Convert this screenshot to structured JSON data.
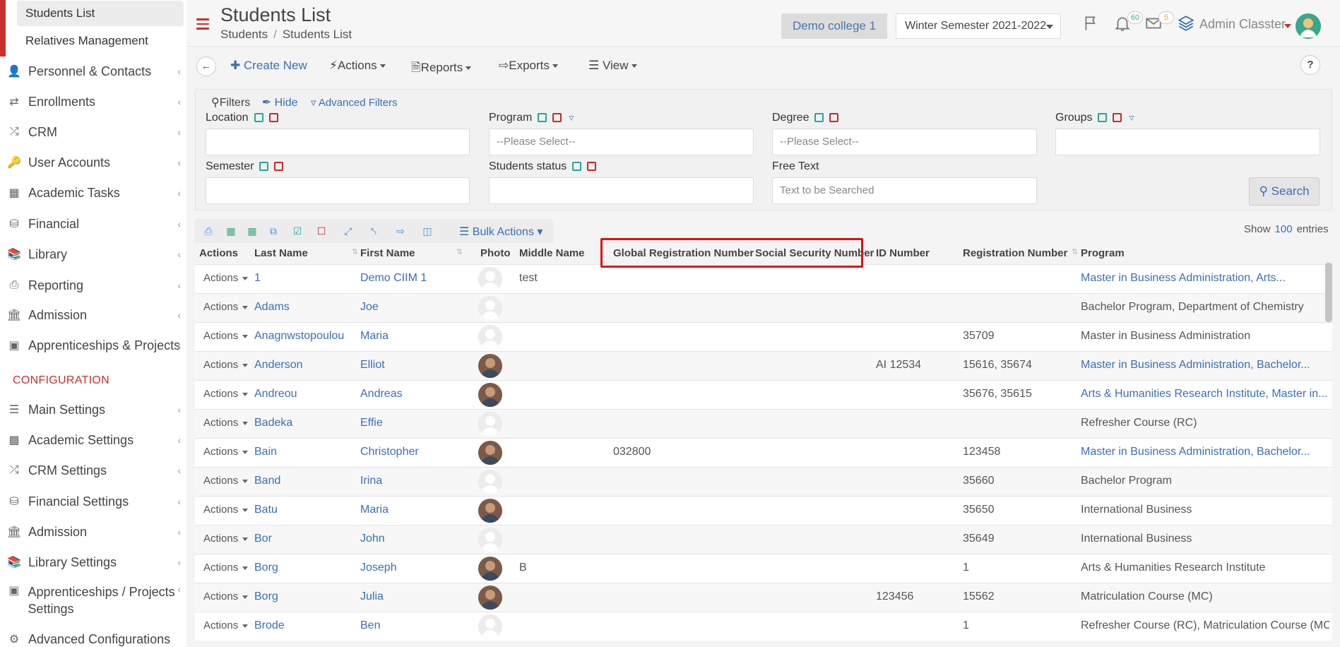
{
  "sidebar": {
    "sub_items": [
      {
        "label": "Students List"
      },
      {
        "label": "Relatives Management"
      }
    ],
    "main_items": [
      {
        "label": "Personnel & Contacts",
        "icon": "person-icon"
      },
      {
        "label": "Enrollments",
        "icon": "arrows-icon"
      },
      {
        "label": "CRM",
        "icon": "shuffle-icon"
      },
      {
        "label": "User Accounts",
        "icon": "key-icon"
      },
      {
        "label": "Academic Tasks",
        "icon": "grid-icon"
      },
      {
        "label": "Financial",
        "icon": "coins-icon"
      },
      {
        "label": "Library",
        "icon": "books-icon"
      },
      {
        "label": "Reporting",
        "icon": "print-icon"
      },
      {
        "label": "Admission",
        "icon": "institution-icon"
      },
      {
        "label": "Apprenticeships & Projects",
        "icon": "box-icon"
      }
    ],
    "config_title": "CONFIGURATION",
    "config_items": [
      {
        "label": "Main Settings",
        "icon": "sliders-icon"
      },
      {
        "label": "Academic Settings",
        "icon": "group-icon"
      },
      {
        "label": "CRM Settings",
        "icon": "shuffle-icon"
      },
      {
        "label": "Financial Settings",
        "icon": "coins-icon"
      },
      {
        "label": "Admission",
        "icon": "institution-icon"
      },
      {
        "label": "Library Settings",
        "icon": "books-icon"
      },
      {
        "label": "Apprenticeships / Projects Settings",
        "icon": "box-icon"
      },
      {
        "label": "Advanced Configurations",
        "icon": "gears-icon"
      }
    ]
  },
  "header": {
    "title": "Students List",
    "breadcrumb": [
      "Students",
      "Students List"
    ],
    "college": "Demo college 1",
    "semester": "Winter Semester 2021-2022",
    "notifications_count": "60",
    "messages_count": "5",
    "user_name": "Admin Classter"
  },
  "toolbar": {
    "create": "Create New",
    "actions": "Actions",
    "reports": "Reports",
    "exports": "Exports",
    "view": "View",
    "help": "?"
  },
  "filters": {
    "title": "Filters",
    "hide": "Hide",
    "advanced": "Advanced Filters",
    "location_label": "Location",
    "program_label": "Program",
    "program_value": "--Please Select--",
    "degree_label": "Degree",
    "degree_value": "--Please Select--",
    "groups_label": "Groups",
    "semester_label": "Semester",
    "status_label": "Students status",
    "freetext_label": "Free Text",
    "freetext_placeholder": "Text to be Searched",
    "search": "Search"
  },
  "table": {
    "bulk_actions": "Bulk Actions",
    "show_label": "Show",
    "show_count": "100",
    "entries_label": "entries",
    "headers": {
      "actions": "Actions",
      "last_name": "Last Name",
      "first_name": "First Name",
      "photo": "Photo",
      "middle_name": "Middle Name",
      "global_reg": "Global Registration Number",
      "ssn": "Social Security Number",
      "id_number": "ID Number",
      "reg_number": "Registration Number",
      "program": "Program"
    },
    "action_label": "Actions",
    "rows": [
      {
        "last": "1",
        "first": "Demo CIIM 1",
        "middle": "test",
        "global": "",
        "ssn": "",
        "id": "",
        "reg": "",
        "program": "Master in Business Administration, Arts...",
        "program_link": true,
        "photo": false
      },
      {
        "last": "Adams",
        "first": "Joe",
        "middle": "",
        "global": "",
        "ssn": "",
        "id": "",
        "reg": "",
        "program": "Bachelor Program, Department of Chemistry",
        "program_link": false,
        "photo": false
      },
      {
        "last": "Anagnwstopoulou",
        "first": "Maria",
        "middle": "",
        "global": "",
        "ssn": "",
        "id": "",
        "reg": "35709",
        "program": "Master in Business Administration",
        "program_link": false,
        "photo": false
      },
      {
        "last": "Anderson",
        "first": "Elliot",
        "middle": "",
        "global": "",
        "ssn": "",
        "id": "AI 12534",
        "reg": "15616, 35674",
        "program": "Master in Business Administration, Bachelor...",
        "program_link": true,
        "photo": true
      },
      {
        "last": "Andreou",
        "first": "Andreas",
        "middle": "",
        "global": "",
        "ssn": "",
        "id": "",
        "reg": "35676, 35615",
        "program": "Arts & Humanities Research Institute, Master in...",
        "program_link": true,
        "photo": true
      },
      {
        "last": "Badeka",
        "first": "Effie",
        "middle": "",
        "global": "",
        "ssn": "",
        "id": "",
        "reg": "",
        "program": "Refresher Course (RC)",
        "program_link": false,
        "photo": false
      },
      {
        "last": "Bain",
        "first": "Christopher",
        "middle": "",
        "global": "032800",
        "ssn": "",
        "id": "",
        "reg": "123458",
        "program": "Master in Business Administration, Bachelor...",
        "program_link": true,
        "photo": true
      },
      {
        "last": "Band",
        "first": "Irina",
        "middle": "",
        "global": "",
        "ssn": "",
        "id": "",
        "reg": "35660",
        "program": "Bachelor Program",
        "program_link": false,
        "photo": false
      },
      {
        "last": "Batu",
        "first": "Maria",
        "middle": "",
        "global": "",
        "ssn": "",
        "id": "",
        "reg": "35650",
        "program": "International Business",
        "program_link": false,
        "photo": true
      },
      {
        "last": "Bor",
        "first": "John",
        "middle": "",
        "global": "",
        "ssn": "",
        "id": "",
        "reg": "35649",
        "program": "International Business",
        "program_link": false,
        "photo": false
      },
      {
        "last": "Borg",
        "first": "Joseph",
        "middle": "B",
        "global": "",
        "ssn": "",
        "id": "",
        "reg": "1",
        "program": "Arts & Humanities Research Institute",
        "program_link": false,
        "photo": true
      },
      {
        "last": "Borg",
        "first": "Julia",
        "middle": "",
        "global": "",
        "ssn": "",
        "id": "123456",
        "reg": "15562",
        "program": "Matriculation Course (MC)",
        "program_link": false,
        "photo": true
      },
      {
        "last": "Brode",
        "first": "Ben",
        "middle": "",
        "global": "",
        "ssn": "",
        "id": "",
        "reg": "1",
        "program": "Refresher Course (RC), Matriculation Course (MC)",
        "program_link": false,
        "photo": false
      }
    ]
  },
  "colors": {
    "accent": "#c9302c",
    "link": "#3a6fb5",
    "highlight": "#e01010"
  }
}
